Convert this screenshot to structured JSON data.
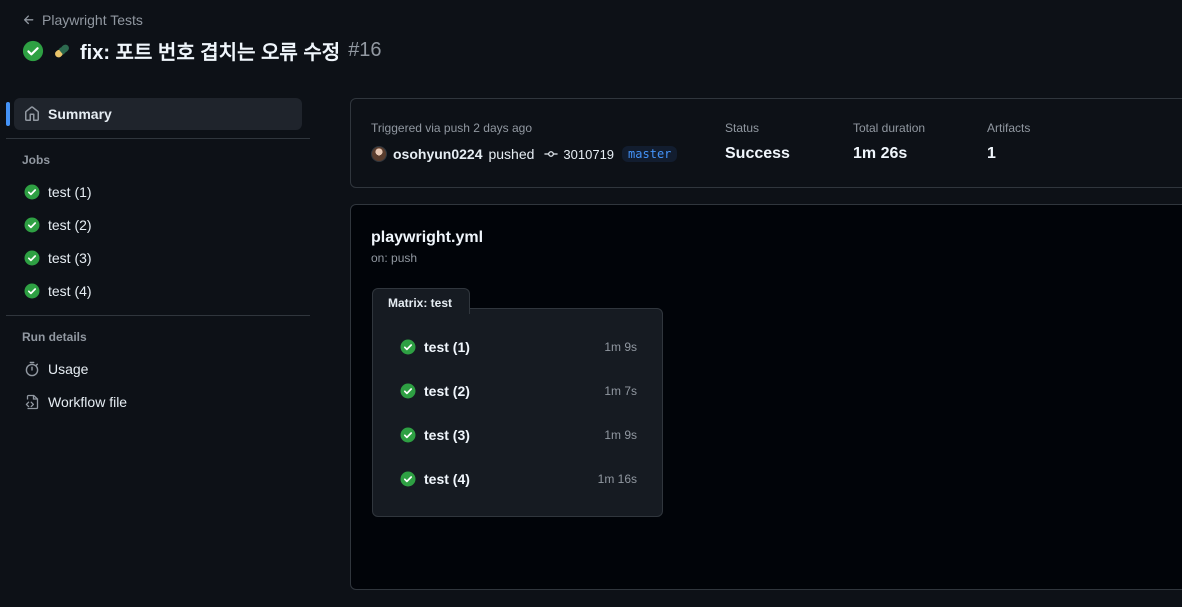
{
  "header": {
    "back_label": "Playwright Tests",
    "title": "fix: 포트 번호 겹치는 오류 수정",
    "run_number": "#16"
  },
  "sidebar": {
    "summary_label": "Summary",
    "jobs_heading": "Jobs",
    "jobs": [
      {
        "label": "test (1)"
      },
      {
        "label": "test (2)"
      },
      {
        "label": "test (3)"
      },
      {
        "label": "test (4)"
      }
    ],
    "run_details_heading": "Run details",
    "details": [
      {
        "label": "Usage",
        "icon": "stopwatch-icon"
      },
      {
        "label": "Workflow file",
        "icon": "file-code-icon"
      }
    ]
  },
  "summary": {
    "triggered": "Triggered via push 2 days ago",
    "user": "osohyun0224",
    "action": "pushed",
    "commit": "3010719",
    "branch": "master",
    "status_label": "Status",
    "status_value": "Success",
    "duration_label": "Total duration",
    "duration_value": "1m 26s",
    "artifacts_label": "Artifacts",
    "artifacts_value": "1"
  },
  "workflow": {
    "file": "playwright.yml",
    "trigger": "on: push",
    "matrix_label": "Matrix: test",
    "jobs": [
      {
        "name": "test (1)",
        "duration": "1m 9s"
      },
      {
        "name": "test (2)",
        "duration": "1m 7s"
      },
      {
        "name": "test (3)",
        "duration": "1m 9s"
      },
      {
        "name": "test (4)",
        "duration": "1m 16s"
      }
    ]
  },
  "colors": {
    "success": "#2ea043",
    "accent": "#4493f8",
    "background": "#0d1117",
    "border": "#30363d"
  }
}
